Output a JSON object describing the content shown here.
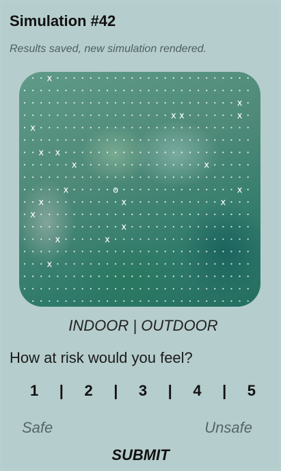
{
  "title": "Simulation #42",
  "status": "Results saved, new simulation rendered.",
  "simulation": {
    "marks": [
      {
        "label": "X",
        "col": 3,
        "row": 0
      },
      {
        "label": "X",
        "col": 18,
        "row": 3
      },
      {
        "label": "X",
        "col": 19,
        "row": 3
      },
      {
        "label": "X",
        "col": 26,
        "row": 2
      },
      {
        "label": "X",
        "col": 26,
        "row": 3
      },
      {
        "label": "X",
        "col": 1,
        "row": 4
      },
      {
        "label": "X",
        "col": 2,
        "row": 6
      },
      {
        "label": "X",
        "col": 4,
        "row": 6
      },
      {
        "label": "X",
        "col": 6,
        "row": 7
      },
      {
        "label": "X",
        "col": 22,
        "row": 7
      },
      {
        "label": "X",
        "col": 5,
        "row": 9
      },
      {
        "label": "O",
        "col": 11,
        "row": 9
      },
      {
        "label": "X",
        "col": 26,
        "row": 9
      },
      {
        "label": "X",
        "col": 2,
        "row": 10
      },
      {
        "label": "X",
        "col": 12,
        "row": 10
      },
      {
        "label": "X",
        "col": 24,
        "row": 10
      },
      {
        "label": "X",
        "col": 1,
        "row": 11
      },
      {
        "label": "X",
        "col": 12,
        "row": 12
      },
      {
        "label": "X",
        "col": 4,
        "row": 13
      },
      {
        "label": "X",
        "col": 10,
        "row": 13
      },
      {
        "label": "X",
        "col": 3,
        "row": 15
      }
    ]
  },
  "mode_label": "INDOOR | OUTDOOR",
  "question": "How at risk would you feel?",
  "scale": {
    "options": [
      "1",
      "2",
      "3",
      "4",
      "5"
    ],
    "separator": "|",
    "min_label": "Safe",
    "max_label": "Unsafe"
  },
  "submit_label": "SUBMIT"
}
